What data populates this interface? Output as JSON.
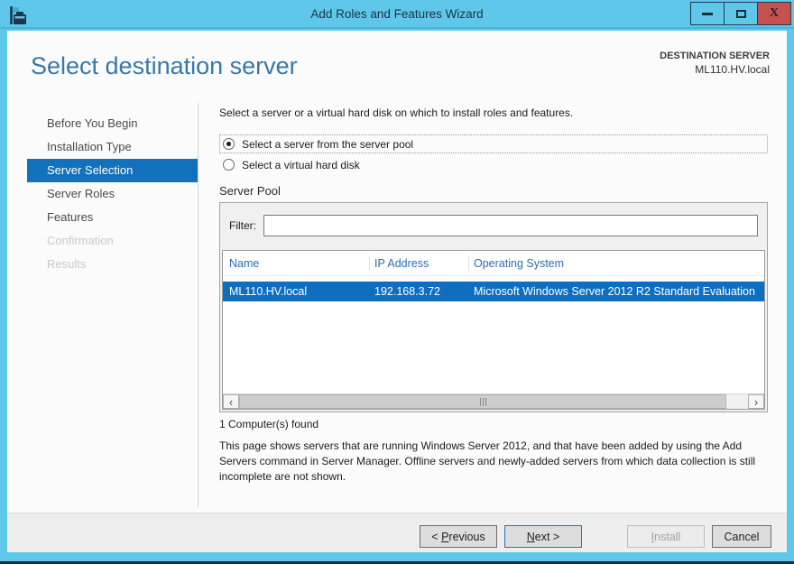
{
  "window": {
    "title": "Add Roles and Features Wizard",
    "close_glyph": "X",
    "icons": {
      "app": "server-manager-icon",
      "minimize": "minimize-icon",
      "maximize": "maximize-icon",
      "close": "close-icon"
    }
  },
  "header": {
    "title": "Select destination server",
    "dest_label": "DESTINATION SERVER",
    "dest_server": "ML110.HV.local"
  },
  "sidebar": {
    "items": [
      {
        "label": "Before You Begin",
        "state": "normal"
      },
      {
        "label": "Installation Type",
        "state": "normal"
      },
      {
        "label": "Server Selection",
        "state": "selected"
      },
      {
        "label": "Server Roles",
        "state": "normal"
      },
      {
        "label": "Features",
        "state": "normal"
      },
      {
        "label": "Confirmation",
        "state": "disabled"
      },
      {
        "label": "Results",
        "state": "disabled"
      }
    ]
  },
  "main": {
    "instruction": "Select a server or a virtual hard disk on which to install roles and features.",
    "radio_server_pool": {
      "label": "Select a server from the server pool",
      "selected": true
    },
    "radio_vhd": {
      "label": "Select a virtual hard disk",
      "selected": false
    },
    "server_pool": {
      "title": "Server Pool",
      "filter_label": "Filter:",
      "filter_value": "",
      "table": {
        "columns": [
          "Name",
          "IP Address",
          "Operating System"
        ],
        "row": {
          "name": "ML110.HV.local",
          "ip": "192.168.3.72",
          "os": "Microsoft Windows Server 2012 R2 Standard Evaluation",
          "selected": true
        }
      },
      "scrollbar": {
        "left_glyph": "‹",
        "right_glyph": "›"
      }
    },
    "count_text": "1 Computer(s) found",
    "description": "This page shows servers that are running Windows Server 2012, and that have been added by using the Add Servers command in Server Manager. Offline servers and newly-added servers from which data collection is still incomplete are not shown."
  },
  "footer": {
    "previous": {
      "pre": "< ",
      "key": "P",
      "post": "revious"
    },
    "next": {
      "pre": "",
      "key": "N",
      "post": "ext >"
    },
    "install": {
      "pre": "",
      "key": "I",
      "post": "nstall"
    },
    "cancel_label": "Cancel"
  },
  "colors": {
    "frame": "#5fc8ea",
    "nav_selected": "#1271bd",
    "row_selected": "#0e6fc1",
    "column_header": "#2a6db2",
    "close_button": "#c75050",
    "heading": "#3878a8"
  }
}
